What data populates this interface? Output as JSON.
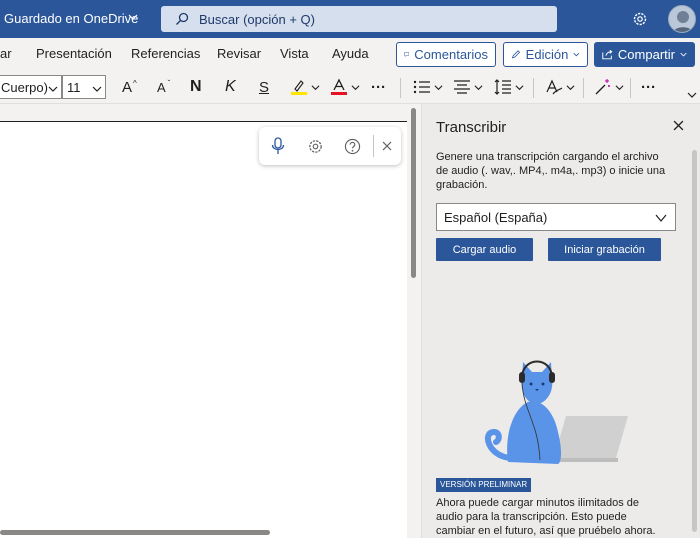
{
  "titlebar": {
    "title": "Guardado en OneDrive",
    "search_placeholder": "Buscar (opción + Q)"
  },
  "menu": {
    "items": [
      "ar",
      "Presentación",
      "Referencias",
      "Revisar",
      "Vista",
      "Ayuda"
    ],
    "comments_label": "Comentarios",
    "editing_label": "Edición",
    "share_label": "Compartir"
  },
  "ribbon": {
    "font_name": "Cuerpo)",
    "font_size": "11",
    "bold": "N",
    "italic": "K",
    "strike": "S",
    "grow_font": "A",
    "shrink_font": "A",
    "highlight_color": "#ffe600",
    "font_color": "#e81123",
    "more": "···"
  },
  "pane": {
    "title": "Transcribir",
    "description": "Genere una transcripción cargando el archivo de audio (. wav,. MP4,. m4a,. mp3) o inicie una grabación.",
    "language": "Español (España)",
    "upload_label": "Cargar audio",
    "record_label": "Iniciar grabación",
    "preview_badge": "VERSIÓN PRELIMINAR",
    "note": "Ahora puede cargar minutos ilimitados de audio para la transcripción. Esto puede cambiar en el futuro, así que pruébelo ahora."
  },
  "colors": {
    "brand": "#2b579a",
    "cat": "#5a94e8",
    "pane_bg": "#edebe9"
  }
}
